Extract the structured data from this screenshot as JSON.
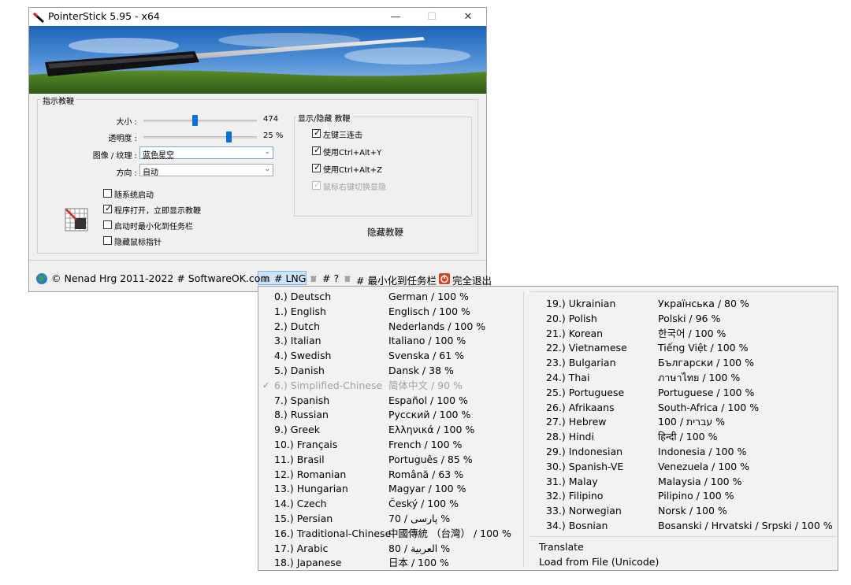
{
  "window": {
    "title": "PointerStick 5.95 - x64",
    "controls": {
      "minimize": "—",
      "maximize": "☐",
      "close": "✕"
    }
  },
  "pointer_group": {
    "label": "指示教鞭",
    "size": {
      "label": "大小 :",
      "value": "474",
      "level": 0.45
    },
    "transparency": {
      "label": "透明度 :",
      "value": "25 %",
      "level": 0.75
    },
    "texture": {
      "label": "图像 / 纹理 :",
      "value": "蓝色星空"
    },
    "direction": {
      "label": "方向 :",
      "value": "自动"
    },
    "options": [
      {
        "label": "随系统启动",
        "checked": false
      },
      {
        "label": "程序打开，立即显示教鞭",
        "checked": true
      },
      {
        "label": "启动时最小化到任务栏",
        "checked": false
      },
      {
        "label": "隐藏鼠标指针",
        "checked": false
      }
    ]
  },
  "toggle_group": {
    "label": "显示/隐藏 教鞭",
    "options": [
      {
        "label": "左键三连击",
        "checked": true,
        "disabled": false
      },
      {
        "label": "使用Ctrl+Alt+Y",
        "checked": true,
        "disabled": false
      },
      {
        "label": "使用Ctrl+Alt+Z",
        "checked": true,
        "disabled": false
      },
      {
        "label": "鼠标右键切换显隐",
        "checked": true,
        "disabled": true
      }
    ],
    "hide_button": "隐藏教鞭"
  },
  "status_bar": {
    "copyright": "© Nenad Hrg 2011-2022 # SoftwareOK.com",
    "lng": "# LNG",
    "help": "# ?",
    "minimize_tray": "# 最小化到任务栏",
    "exit": "完全退出"
  },
  "language_menu": {
    "left": [
      {
        "name": "0.) Deutsch",
        "native": "German / 100 %"
      },
      {
        "name": "1.) English",
        "native": "Englisch / 100 %"
      },
      {
        "name": "2.) Dutch",
        "native": "Nederlands / 100 %"
      },
      {
        "name": "3.) Italian",
        "native": "Italiano / 100 %"
      },
      {
        "name": "4.) Swedish",
        "native": "Svenska / 61 %"
      },
      {
        "name": "5.) Danish",
        "native": "Dansk / 38 %"
      },
      {
        "name": "6.) Simplified-Chinese",
        "native": "简体中文 / 90 %",
        "selected": true
      },
      {
        "name": "7.) Spanish",
        "native": "Español / 100 %"
      },
      {
        "name": "8.) Russian",
        "native": "Русский / 100 %"
      },
      {
        "name": "9.) Greek",
        "native": "Ελληνικά / 100 %"
      },
      {
        "name": "10.) Français",
        "native": "French / 100 %"
      },
      {
        "name": "11.) Brasil",
        "native": "Português / 85 %"
      },
      {
        "name": "12.) Romanian",
        "native": "Română / 63 %"
      },
      {
        "name": "13.) Hungarian",
        "native": "Magyar / 100 %"
      },
      {
        "name": "14.) Czech",
        "native": "Český / 100 %"
      },
      {
        "name": "15.) Persian",
        "native": "70 / پارسی %"
      },
      {
        "name": "16.) Traditional-Chinese",
        "native": "中國傳統 （台灣） / 100 %"
      },
      {
        "name": "17.) Arabic",
        "native": "80 / العربية %"
      },
      {
        "name": "18.) Japanese",
        "native": "日本 / 100 %"
      }
    ],
    "right": [
      {
        "name": "19.) Ukrainian",
        "native": "Українська / 80 %"
      },
      {
        "name": "20.) Polish",
        "native": "Polski / 96 %"
      },
      {
        "name": "21.) Korean",
        "native": "한국어 / 100 %"
      },
      {
        "name": "22.) Vietnamese",
        "native": "Tiếng Việt / 100 %"
      },
      {
        "name": "23.) Bulgarian",
        "native": "Български / 100 %"
      },
      {
        "name": "24.) Thai",
        "native": "ภาษาไทย / 100 %"
      },
      {
        "name": "25.) Portuguese",
        "native": "Portuguese / 100 %"
      },
      {
        "name": "26.) Afrikaans",
        "native": "South-Africa / 100 %"
      },
      {
        "name": "27.) Hebrew",
        "native": "100 / עברית %"
      },
      {
        "name": "28.) Hindi",
        "native": "हिन्दी / 100 %"
      },
      {
        "name": "29.) Indonesian",
        "native": "Indonesia / 100 %"
      },
      {
        "name": "30.) Spanish-VE",
        "native": "Venezuela / 100 %"
      },
      {
        "name": "31.) Malay",
        "native": "Malaysia / 100 %"
      },
      {
        "name": "32.) Filipino",
        "native": "Pilipino / 100 %"
      },
      {
        "name": "33.) Norwegian",
        "native": "Norsk / 100 %"
      },
      {
        "name": "34.) Bosnian",
        "native": "Bosanski / Hrvatski / Srpski / 100 %"
      }
    ],
    "translate": "Translate",
    "load_file": "Load from File (Unicode)"
  },
  "icons": {
    "app": "pointer-stick-icon",
    "feature": "grid-pointer-icon",
    "globe": "globe-icon",
    "exit": "power-icon"
  }
}
